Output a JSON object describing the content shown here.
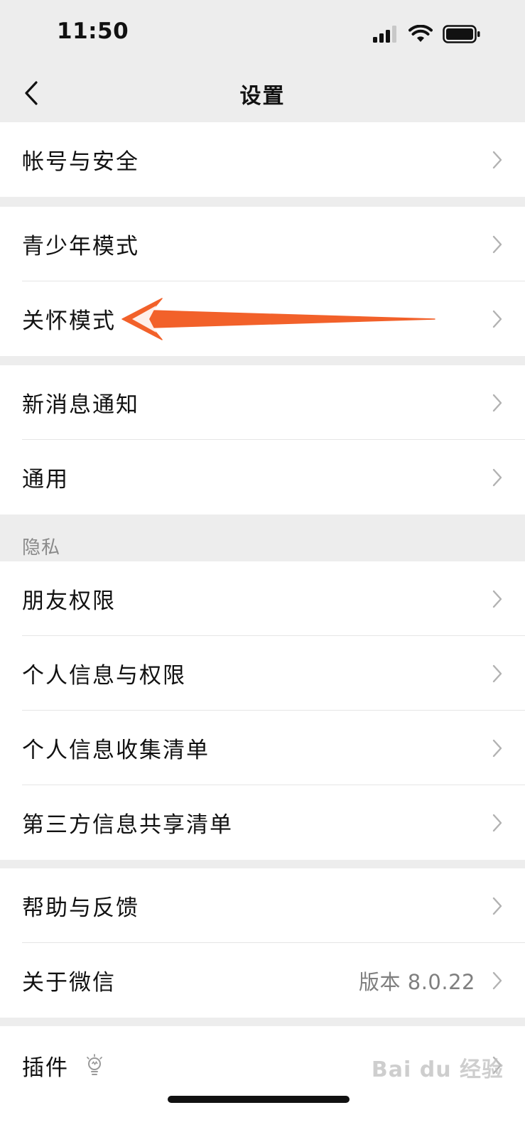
{
  "status_bar": {
    "time": "11:50"
  },
  "nav": {
    "title": "设置"
  },
  "groups": {
    "account": {
      "items": [
        {
          "label": "帐号与安全"
        }
      ]
    },
    "modes": {
      "items": [
        {
          "label": "青少年模式"
        },
        {
          "label": "关怀模式"
        }
      ]
    },
    "general": {
      "items": [
        {
          "label": "新消息通知"
        },
        {
          "label": "通用"
        }
      ]
    },
    "privacy": {
      "title": "隐私",
      "items": [
        {
          "label": "朋友权限"
        },
        {
          "label": "个人信息与权限"
        },
        {
          "label": "个人信息收集清单"
        },
        {
          "label": "第三方信息共享清单"
        }
      ]
    },
    "about": {
      "items": [
        {
          "label": "帮助与反馈"
        },
        {
          "label": "关于微信",
          "value": "版本 8.0.22"
        }
      ]
    },
    "plugins": {
      "items": [
        {
          "label": "插件"
        }
      ]
    }
  },
  "annotation": {
    "color": "#f2612a"
  },
  "watermark": "Bai du 经验"
}
